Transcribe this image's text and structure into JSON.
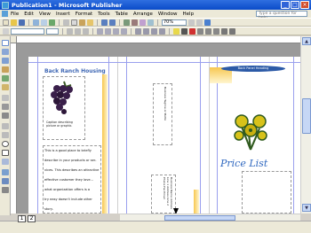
{
  "window": {
    "title": "Publication1 - Microsoft Publisher",
    "buttons": {
      "minimize": "_",
      "maximize": "□",
      "close": "×"
    }
  },
  "menu": {
    "items": [
      "File",
      "Edit",
      "View",
      "Insert",
      "Format",
      "Tools",
      "Table",
      "Arrange",
      "Window",
      "Help"
    ],
    "help_placeholder": "Type a question for help"
  },
  "toolbar": {
    "zoom": "70%"
  },
  "page": {
    "heading": "Back Ranch Housing",
    "caption": "Caption describing picture or graphic.",
    "body_lines": [
      "This is a good place to briefly",
      "describe in your products or ser-",
      "vices. This describes an attractive",
      "effective customer they love...",
      "what organization offers is a",
      "try easy doesn't include other",
      "story."
    ],
    "banner_text": "Back Panel Heading",
    "price_list": "Price List",
    "vertical_text_a": "Business Tagline or Motto",
    "vertical_text_b": "Business Name Address Line 1 Address Line 2 Phone Fax Email"
  },
  "page_tabs": [
    "1",
    "2"
  ],
  "colors": {
    "title_bar": "#0a4bc9",
    "accent_blue": "#3f67b4",
    "accent_yellow": "#f7c750",
    "grape_purple": "#3a1f4a",
    "flower_yellow": "#d8c21a"
  }
}
